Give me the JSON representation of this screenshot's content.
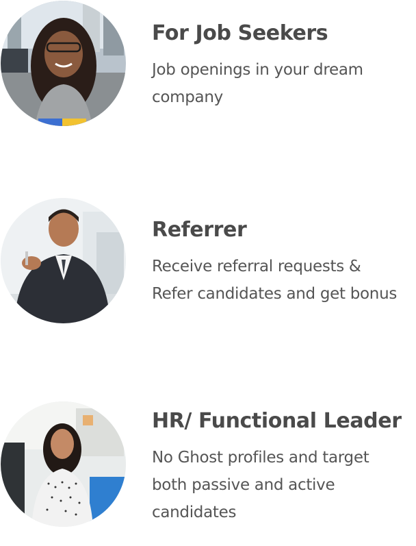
{
  "cards": [
    {
      "title": "For Job Seekers",
      "lines": [
        "Job openings in your dream",
        "company"
      ],
      "icon": "job-seeker-photo"
    },
    {
      "title": "Referrer",
      "lines": [
        "Receive referral requests &",
        "Refer candidates and get bonus"
      ],
      "icon": "referrer-photo"
    },
    {
      "title": "HR/ Functional Leader",
      "lines": [
        "No Ghost profiles and target",
        "both passive and active",
        "candidates"
      ],
      "icon": "hr-leader-photo"
    }
  ],
  "colors": {
    "title": "#4a4a4a",
    "text": "#555555",
    "background": "#ffffff"
  }
}
